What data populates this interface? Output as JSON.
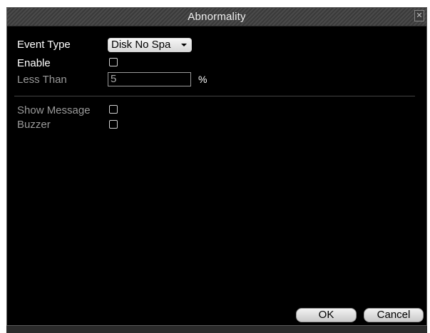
{
  "window": {
    "title": "Abnormality",
    "close_glyph": "✕"
  },
  "form": {
    "event_type": {
      "label": "Event Type",
      "selected": "Disk No Spa"
    },
    "enable": {
      "label": "Enable",
      "checked": false
    },
    "less_than": {
      "label": "Less Than",
      "value": "5",
      "unit": "%"
    },
    "show_message": {
      "label": "Show Message",
      "checked": false
    },
    "buzzer": {
      "label": "Buzzer",
      "checked": false
    }
  },
  "buttons": {
    "ok": "OK",
    "cancel": "Cancel"
  },
  "colors": {
    "background": "#000000",
    "text_active": "#ffffff",
    "text_disabled": "#9a9a9a"
  }
}
